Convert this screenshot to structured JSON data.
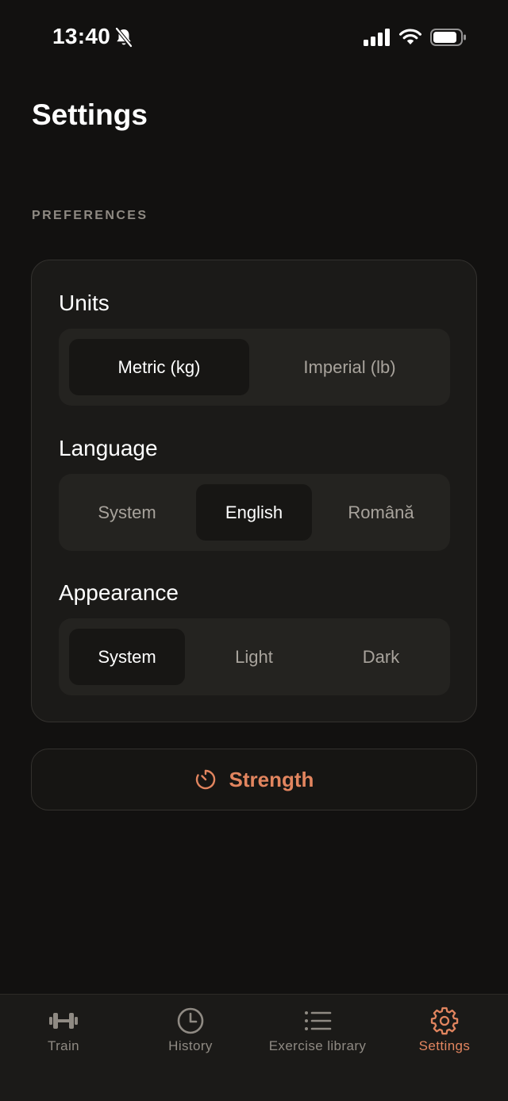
{
  "status_bar": {
    "time": "13:40",
    "icons": [
      "bell-slash-icon",
      "signal-icon",
      "wifi-icon",
      "battery-icon"
    ]
  },
  "page": {
    "title": "Settings"
  },
  "preferences": {
    "section_header": "PREFERENCES",
    "units": {
      "label": "Units",
      "options": [
        "Metric (kg)",
        "Imperial (lb)"
      ],
      "selected": "Metric (kg)"
    },
    "language": {
      "label": "Language",
      "options": [
        "System",
        "English",
        "Română"
      ],
      "selected": "English"
    },
    "appearance": {
      "label": "Appearance",
      "options": [
        "System",
        "Light",
        "Dark"
      ],
      "selected": "System"
    }
  },
  "strength_button": {
    "label": "Strength",
    "icon": "timer-icon"
  },
  "tab_bar": {
    "tabs": [
      {
        "label": "Train",
        "icon": "dumbbell-icon"
      },
      {
        "label": "History",
        "icon": "clock-icon"
      },
      {
        "label": "Exercise library",
        "icon": "list-icon"
      },
      {
        "label": "Settings",
        "icon": "gear-icon"
      }
    ],
    "active": "Settings"
  },
  "colors": {
    "background": "#121110",
    "card": "#1b1a18",
    "accent": "#e2855f",
    "muted_text": "#8f8a83"
  }
}
